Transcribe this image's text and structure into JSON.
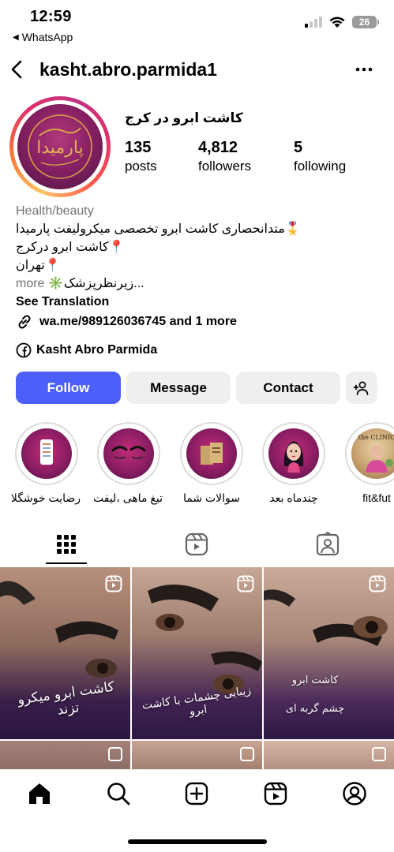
{
  "status_bar": {
    "time": "12:59",
    "back_app": "WhatsApp",
    "battery": "26"
  },
  "header": {
    "username": "kasht.abro.parmida1",
    "back_icon": "chevron-left-icon",
    "more_icon": "ellipsis-icon"
  },
  "profile": {
    "avatar_logo_text": "پارمیدا",
    "display_name": "کاشت ابرو در کرج",
    "stats": [
      {
        "value": "135",
        "label": "posts"
      },
      {
        "value": "4,812",
        "label": "followers"
      },
      {
        "value": "5",
        "label": "following"
      }
    ],
    "category": "Health/beauty",
    "bio_lines": [
      "🎖️متدانحصاری کاشت ابرو تخصصی میکرولیفت پارمیدا",
      "📍کاشت ابرو درکرج",
      "📍تهران"
    ],
    "bio_more_line": "✳️زیرنظرپزشک...",
    "more_label": "more",
    "see_translation": "See Translation",
    "link_text": "wa.me/989126036745 and 1 more",
    "facebook_name": "Kasht Abro Parmida"
  },
  "buttons": {
    "follow": "Follow",
    "message": "Message",
    "contact": "Contact"
  },
  "highlights": [
    {
      "label": "رضایت خوشگلا"
    },
    {
      "label": "تیغ ماهی ،لیفت"
    },
    {
      "label": "سوالات شما"
    },
    {
      "label": "چندماه بعد"
    },
    {
      "label": "fit&fut"
    }
  ],
  "highlight_5_text": "the CLINIC",
  "tabs": [
    {
      "name": "grid",
      "icon": "grid-icon"
    },
    {
      "name": "reels",
      "icon": "reels-icon"
    },
    {
      "name": "tagged",
      "icon": "tagged-person-icon"
    }
  ],
  "posts": [
    {
      "caption": "کاشت ابرو میکرو تزند"
    },
    {
      "caption": "زیبایی چشمات با کاشت ابرو"
    },
    {
      "caption_line1": "کاشت ابرو",
      "caption_line2": "چشم گربه ای"
    }
  ],
  "bottom_nav": [
    "home-icon",
    "search-icon",
    "create-icon",
    "reels-icon",
    "profile-icon"
  ],
  "colors": {
    "follow_button": "#4c5ff8",
    "secondary_button": "#efefef",
    "muted_text": "#737373"
  }
}
